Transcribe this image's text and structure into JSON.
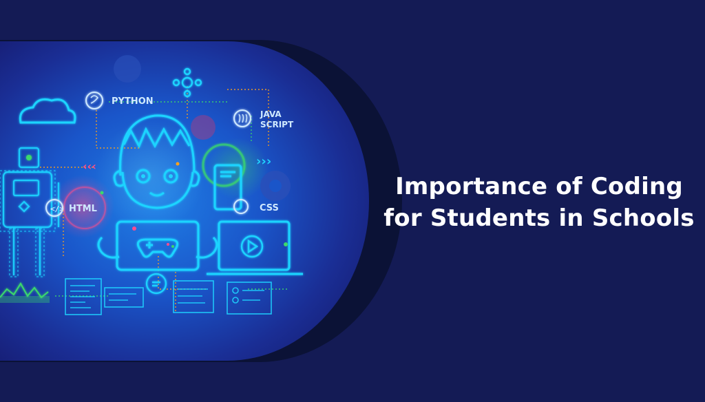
{
  "headline": {
    "line1": "Importance of Coding",
    "line2": "for Students in Schools"
  },
  "illustration": {
    "labels": {
      "python": "PYTHON",
      "java_line1": "JAVA",
      "java_line2": "SCRIPT",
      "html": "HTML",
      "css": "CSS"
    },
    "icons": [
      "cloud-icon",
      "python-icon",
      "crosshair-icon",
      "javascript-icon",
      "robot-icon",
      "boy-icon",
      "gamepad-icon",
      "laptop-icon",
      "play-icon",
      "phone-icon",
      "chat-icon",
      "checklist-icon",
      "code-window-icon",
      "chevrons-icon",
      "gear-icon"
    ]
  },
  "colors": {
    "background": "#141b55",
    "capsule_shadow": "#0b1236",
    "neon_cyan": "#1fd4ff",
    "neon_pink": "#ff4d8d",
    "neon_green": "#3bd96c",
    "neon_orange": "#ffa21a",
    "headline": "#ffffff"
  }
}
